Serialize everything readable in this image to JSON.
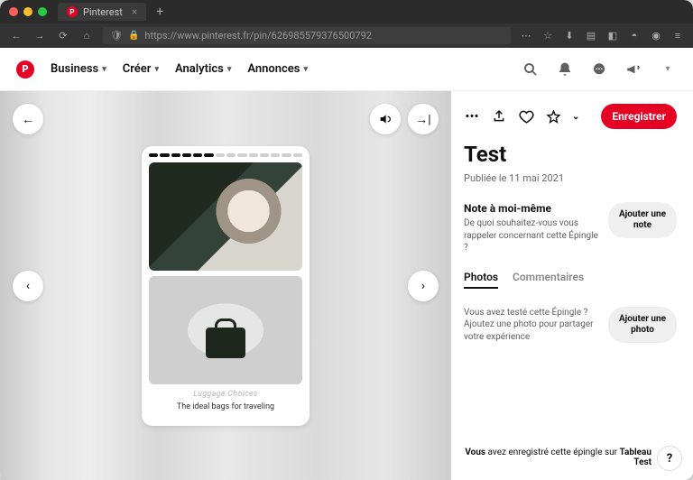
{
  "browser": {
    "tab_title": "Pinterest",
    "url": "https://www.pinterest.fr/pin/626985579376500792"
  },
  "header": {
    "business": "Business",
    "creer": "Créer",
    "analytics": "Analytics",
    "annonces": "Annonces"
  },
  "pin_card": {
    "caption": "Luggage Choices",
    "subcaption": "The ideal bags for traveling"
  },
  "panel": {
    "save": "Enregistrer",
    "title": "Test",
    "published": "Publiée le 11 mai 2021",
    "note_heading": "Note à moi-même",
    "note_body": "De quoi souhaitez-vous vous rappeler concernant cette Épingle ?",
    "note_btn": "Ajouter une note",
    "tabs": {
      "photos": "Photos",
      "comments": "Commentaires"
    },
    "tried_body": "Vous avez testé cette Épingle ? Ajoutez une photo pour partager votre expérience",
    "tried_btn": "Ajouter une photo",
    "footer_prefix": "Vous",
    "footer_mid": " avez enregistré cette épingle sur ",
    "footer_board": "Tableau Test"
  }
}
